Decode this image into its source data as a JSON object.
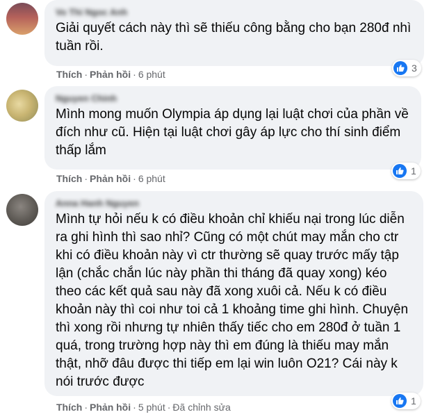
{
  "comments": [
    {
      "author": "Vo Thi Ngoc Anh",
      "text": "Giải quyết cách này thì sẽ thiếu công bằng cho bạn 280đ nhì tuần rồi.",
      "like_label": "Thích",
      "reply_label": "Phản hồi",
      "time": "6 phút",
      "reaction_count": "3",
      "avatar_color": "#a0524a"
    },
    {
      "author": "Nguyen Chinh",
      "text": "Mình mong muốn Olympia áp dụng lại luật chơi của phần về đích như cũ. Hiện tại luật chơi gây áp lực cho thí sinh điểm thấp lắm",
      "like_label": "Thích",
      "reply_label": "Phản hồi",
      "time": "6 phút",
      "reaction_count": "1",
      "avatar_color": "#c9b572"
    },
    {
      "author": "Anna Hanh Nguyen",
      "text": "Mình tự hỏi nếu k có điều khoản chỉ khiếu nại trong lúc diễn ra ghi hình thì sao nhỉ? Cũng có một chút may mắn cho ctr khi có điều khoản này vì ctr thường sẽ quay trước mấy tập lận (chắc chắn lúc này phần thi tháng đã quay xong) kéo theo các kết quả sau này đã xong xuôi cả. Nếu k có điều khoản này thì coi như toi cả 1 khoảng time ghi hình. Chuyện thì xong rồi nhưng tự nhiên thấy tiếc cho em 280đ ở tuần 1 quá, trong trường hợp này thì em đúng là thiếu may mắn thật, nhỡ đâu được thi tiếp em lại win luôn O21? Cái này k nói trước được",
      "like_label": "Thích",
      "reply_label": "Phản hồi",
      "time": "5 phút",
      "edited_label": "Đã chỉnh sửa",
      "reaction_count": "1",
      "avatar_color": "#5e5a55"
    }
  ],
  "colors": {
    "bubble": "#f0f2f5",
    "meta": "#65676b",
    "like_blue": "#1877f2"
  }
}
